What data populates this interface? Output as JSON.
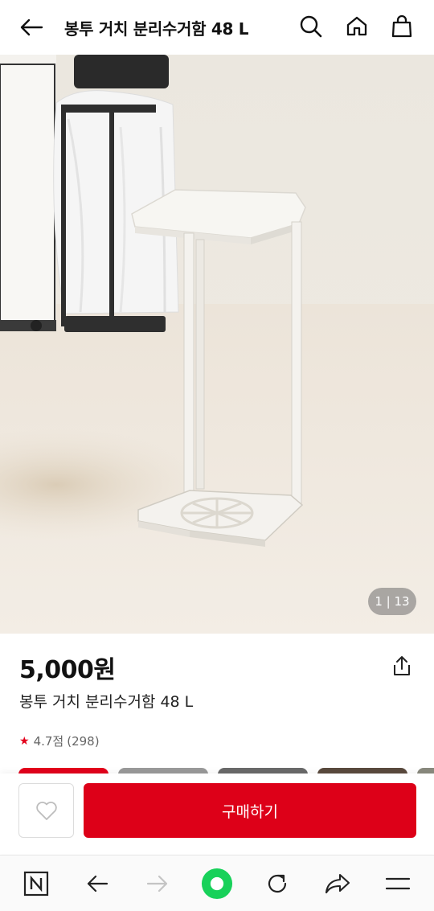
{
  "header": {
    "title": "봉투 거치 분리수거함 48 L",
    "icons": [
      "back-arrow-icon",
      "search-icon",
      "home-icon",
      "shopping-bag-icon"
    ]
  },
  "gallery": {
    "counter": "1 | 13"
  },
  "product": {
    "price": "5,000원",
    "name": "봉투 거치 분리수거함 48 L",
    "rating": "4.7점",
    "review_count": "(298)"
  },
  "actions": {
    "purchase_label": "구매하기",
    "wishlist_icon": "heart-icon",
    "share_icon": "share-icon"
  },
  "colors": {
    "accent": "#dd0018",
    "star": "#e3001b"
  },
  "browser_nav": {
    "icons": [
      "naver-n-icon",
      "back-icon",
      "forward-icon",
      "green-dot-icon",
      "refresh-icon",
      "share-arrow-icon",
      "menu-icon"
    ]
  }
}
